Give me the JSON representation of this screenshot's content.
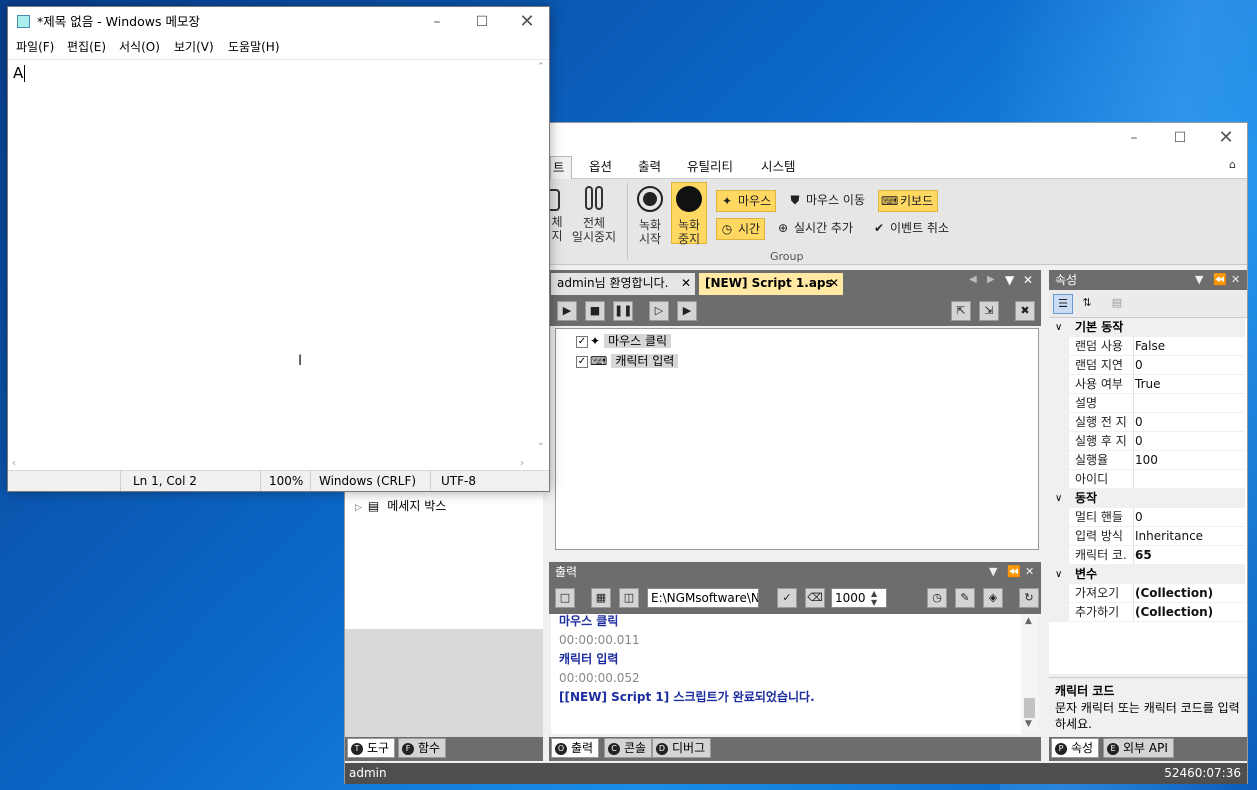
{
  "notepad": {
    "title": "*제목 없음 - Windows 메모장",
    "menu": [
      "파일(F)",
      "편집(E)",
      "서식(O)",
      "보기(V)",
      "도움말(H)"
    ],
    "content": "A",
    "status": {
      "position": "Ln 1, Col 2",
      "zoom": "100%",
      "line_ending": "Windows (CRLF)",
      "encoding": "UTF-8"
    }
  },
  "app": {
    "ribbon_tabs": [
      "트",
      "옵션",
      "출력",
      "유틸리티",
      "시스템"
    ],
    "ribbon": {
      "partial_btn": "체\n지",
      "pause_all": "전체\n일시중지",
      "record_start": "녹화\n시작",
      "record_stop": "녹화\n중지",
      "mouse": "마우스",
      "mouse_move": "마우스 이동",
      "keyboard": "키보드",
      "time": "시간",
      "realtime_add": "실시간 추가",
      "event_cancel": "이벤트 취소",
      "group_label": "Group"
    },
    "doc_tabs": [
      "admin님 환영합니다.",
      "[NEW] Script 1.aps"
    ],
    "script_items": [
      "마우스 클릭",
      "캐릭터 입력"
    ],
    "left_panel": {
      "item": "메세지 박스",
      "tabs": [
        "도구",
        "함수"
      ]
    },
    "properties": {
      "title": "속성",
      "categories": [
        {
          "name": "기본 동작",
          "rows": [
            {
              "k": "랜덤 사용",
              "v": "False"
            },
            {
              "k": "랜덤 지연",
              "v": "0"
            },
            {
              "k": "사용 여부",
              "v": "True"
            },
            {
              "k": "설명",
              "v": ""
            },
            {
              "k": "실행 전 지",
              "v": "0"
            },
            {
              "k": "실행 후 지",
              "v": "0"
            },
            {
              "k": "실행율",
              "v": "100"
            },
            {
              "k": "아이디",
              "v": ""
            }
          ]
        },
        {
          "name": "동작",
          "rows": [
            {
              "k": "멀티 핸들",
              "v": "0"
            },
            {
              "k": "입력 방식",
              "v": "Inheritance"
            },
            {
              "k": "캐릭터 코.",
              "v": "65"
            }
          ]
        },
        {
          "name": "변수",
          "rows": [
            {
              "k": "가져오기",
              "v": "(Collection)"
            },
            {
              "k": "추가하기",
              "v": "(Collection)"
            }
          ]
        }
      ],
      "desc_title": "캐릭터 코드",
      "desc_text": "문자 캐릭터 또는 캐릭터 코드를 입력하세요.",
      "tabs": [
        "속성",
        "외부 API"
      ]
    },
    "output": {
      "title": "출력",
      "path": "E:\\NGMsoftware\\NG",
      "interval": "1000",
      "lines": [
        {
          "text": "마우스 클릭",
          "kind": "action"
        },
        {
          "text": "00:00:00.011",
          "kind": "time"
        },
        {
          "text": "캐릭터 입력",
          "kind": "action"
        },
        {
          "text": "00:00:00.052",
          "kind": "time"
        },
        {
          "text": "[[NEW] Script 1] 스크립트가 완료되었습니다.",
          "kind": "action"
        }
      ],
      "tabs": [
        "출력",
        "콘솔",
        "디버그"
      ]
    },
    "statusbar": {
      "user": "admin",
      "time": "52460:07:36"
    }
  },
  "colors": {
    "accent_yellow": "#ffd862",
    "output_blue": "#1c2d9e",
    "dark_bar": "#6d6d6d"
  }
}
